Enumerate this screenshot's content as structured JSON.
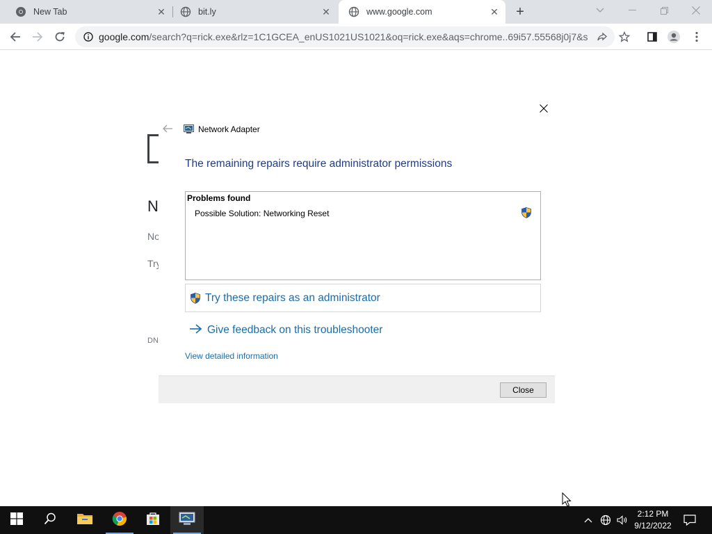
{
  "browser": {
    "tabs": [
      {
        "label": "New Tab",
        "icon": "chrome-icon",
        "active": false
      },
      {
        "label": "bit.ly",
        "icon": "globe-icon",
        "active": false
      },
      {
        "label": "www.google.com",
        "icon": "globe-icon",
        "active": true
      }
    ],
    "address_host": "google.com",
    "address_rest": "/search?q=rick.exe&rlz=1C1GCEA_enUS1021US1021&oq=rick.exe&aqs=chrome..69i57.55568j0j7&s..."
  },
  "background_page": {
    "fragments": [
      "N",
      "No",
      "Try",
      "DN"
    ]
  },
  "dialog": {
    "app_title": "Network Adapter",
    "heading": "The remaining repairs require administrator permissions",
    "problems_header": "Problems found",
    "problem_item": "Possible Solution: Networking Reset",
    "try_repairs": "Try these repairs as an administrator",
    "feedback": "Give feedback on this troubleshooter",
    "view_details": "View detailed information",
    "close_button": "Close"
  },
  "taskbar": {
    "time": "2:12 PM",
    "date": "9/12/2022",
    "apps": [
      "start-icon",
      "search-icon",
      "file-explorer-icon",
      "chrome-icon",
      "store-icon",
      "troubleshooter-icon"
    ]
  },
  "colors": {
    "link": "#1b6ca8",
    "heading": "#1f3c88",
    "taskbar": "#101010"
  }
}
